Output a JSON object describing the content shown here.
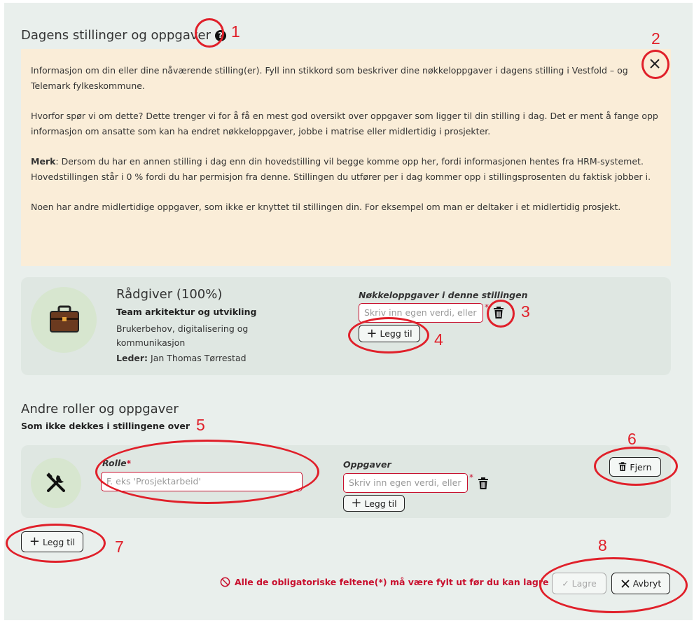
{
  "section1": {
    "title": "Dagens stillinger og oppgaver",
    "help_icon": "question-circle-icon",
    "close_icon": "close-x-icon",
    "info": {
      "p1": "Informasjon om din eller dine nåværende stilling(er). Fyll inn stikkord som beskriver dine nøkkeloppgaver i dagens stilling i Vestfold – og Telemark fylkeskommune.",
      "p2": "Hvorfor spør vi om dette? Dette trenger vi for å få en mest god oversikt over oppgaver som ligger til din stilling i dag. Det er ment å fange opp informasjon om ansatte som kan ha endret nøkkeloppgaver, jobbe i matrise eller midlertidig i prosjekter.",
      "p3_bold": "Merk",
      "p3": ": Dersom du har en annen stilling i dag enn din hovedstilling vil begge komme opp her, fordi informasjonen hentes fra HRM-systemet. Hovedstillingen står i 0 % fordi du har permisjon fra denne. Stillingen du utfører per i dag kommer opp i stillingsprosenten du faktisk jobber i.",
      "p4": "Noen har andre midlertidige oppgaver, som ikke er knyttet til stillingen din. For eksempel om man er deltaker i et midlertidig prosjekt."
    }
  },
  "position": {
    "icon": "briefcase-icon",
    "title": "Rådgiver (100%)",
    "team": "Team arkitektur og utvikling",
    "area": "Brukerbehov, digitalisering og kommunikasjon",
    "leader_label": "Leder:",
    "leader_name": " Jan Thomas Tørrestad",
    "tasks_label": "Nøkkeloppgaver i denne stillingen",
    "tasks_placeholder": "Skriv inn egen verdi, eller",
    "required_mark": "*",
    "add_label": "Legg til"
  },
  "section2": {
    "title": "Andre roller og oppgaver",
    "subtitle": "Som ikke dekkes i stillingene over",
    "role_icon": "tools-icon",
    "role_label": "Rolle",
    "required_mark": "*",
    "role_placeholder": "F. eks 'Prosjektarbeid'",
    "tasks_label": "Oppgaver",
    "tasks_placeholder": "Skriv inn egen verdi, eller",
    "add_task_label": "Legg til",
    "remove_label": "Fjern",
    "add_role_label": "Legg til"
  },
  "footer": {
    "warning": "Alle de obligatoriske feltene(*) må være fylt ut før du kan lagre",
    "save_label": "Lagre",
    "cancel_label": "Avbryt"
  },
  "annotations": [
    "1",
    "2",
    "3",
    "4",
    "5",
    "6",
    "7",
    "8"
  ],
  "colors": {
    "accent_red": "#e0202a",
    "required": "#c8102e",
    "info_bg": "#faedd8",
    "page_bg": "#e9efec"
  }
}
